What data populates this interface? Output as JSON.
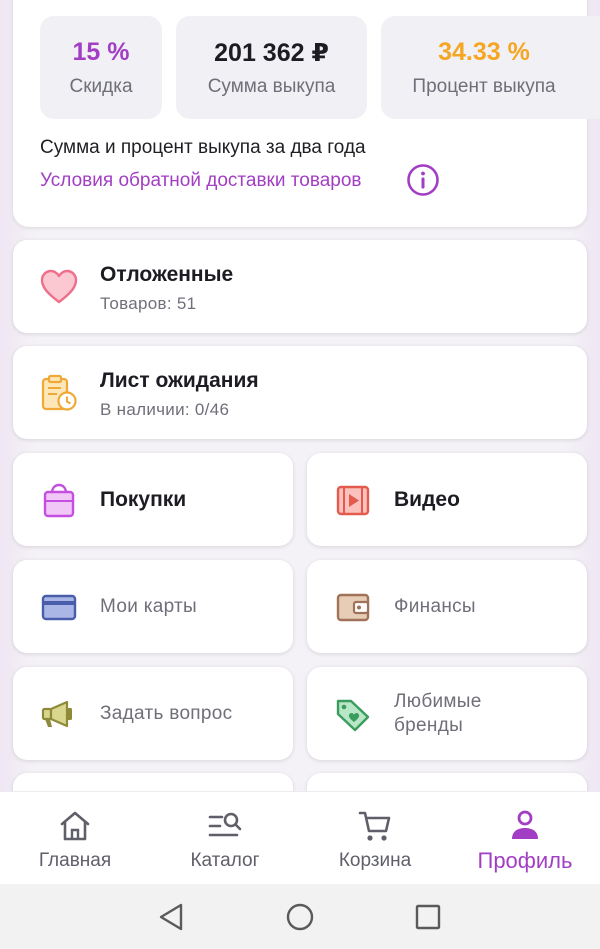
{
  "stats": {
    "discount": {
      "value": "15 %",
      "label": "Скидка",
      "color": "#a23ec4"
    },
    "sum": {
      "value": "201 362 ₽",
      "label": "Сумма выкупа",
      "color": "#1c1c22"
    },
    "percent": {
      "value": "34.33 %",
      "label": "Процент выкупа",
      "color": "#f5a623"
    },
    "note": "Сумма и процент выкупа за два года",
    "link": "Условия обратной доставки товаров",
    "info_icon": "info-circle-icon"
  },
  "deferred": {
    "title": "Отложенные",
    "subtitle": "Товаров: 51",
    "icon": "heart-icon"
  },
  "waitlist": {
    "title": "Лист ожидания",
    "subtitle": "В наличии: 0/46",
    "icon": "clipboard-clock-icon"
  },
  "tiles": {
    "purchases": {
      "label": "Покупки",
      "icon": "shopping-bag-icon"
    },
    "video": {
      "label": "Видео",
      "icon": "video-play-icon"
    },
    "cards": {
      "label": "Мои карты",
      "icon": "credit-card-icon"
    },
    "finance": {
      "label": "Финансы",
      "icon": "wallet-icon"
    },
    "question": {
      "label": "Задать вопрос",
      "icon": "megaphone-icon"
    },
    "brands": {
      "label": "Любимые бренды",
      "icon": "heart-tag-icon"
    }
  },
  "nav": {
    "home": "Главная",
    "catalog": "Каталог",
    "cart": "Корзина",
    "profile": "Профиль",
    "active": "profile",
    "accent": "#a23ec4"
  },
  "system": {
    "back": "back-triangle-icon",
    "home": "home-circle-icon",
    "recents": "recents-square-icon"
  }
}
